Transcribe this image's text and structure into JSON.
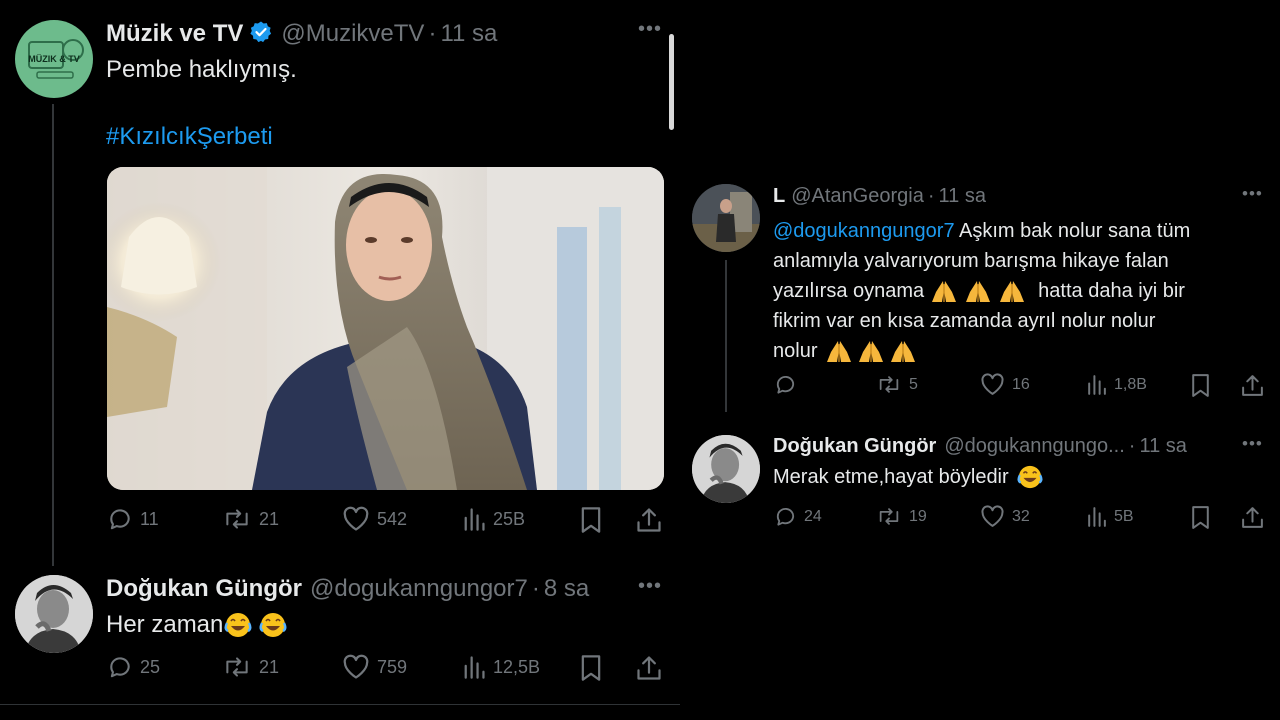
{
  "left": {
    "tweet1": {
      "avatar_text": "MÜZIK & TV",
      "name": "Müzik ve TV",
      "handle": "@MuzikveTV",
      "time": "11 sa",
      "text": "Pembe haklıymış.",
      "hashtag": "#KızılcıkŞerbeti",
      "stats": {
        "replies": "11",
        "retweets": "21",
        "likes": "542",
        "views": "25B"
      }
    },
    "tweet2": {
      "name": "Doğukan Güngör",
      "handle": "@dogukanngungor7",
      "time": "8 sa",
      "text": "Her zaman",
      "stats": {
        "replies": "25",
        "retweets": "21",
        "likes": "759",
        "views": "12,5B"
      }
    }
  },
  "right": {
    "tweet1": {
      "name": "L",
      "handle": "@AtanGeorgia",
      "time": "11 sa",
      "mention": "@dogukanngungor7",
      "text_line1": " Aşkım bak nolur sana tüm",
      "text_line2": "anlamıyla yalvarıyorum barışma hikaye falan",
      "text_line3": "yazılırsa oynama",
      "text_line3b": "hatta daha iyi bir",
      "text_line4": "fikrim var en kısa zamanda ayrıl nolur nolur",
      "text_line5": "nolur",
      "stats": {
        "replies": "",
        "retweets": "5",
        "likes": "16",
        "views": "1,8B"
      }
    },
    "tweet2": {
      "name": "Doğukan Güngör",
      "handle": "@dogukanngungo...",
      "time": "11 sa",
      "text": "Merak etme,hayat böyledir",
      "stats": {
        "replies": "24",
        "retweets": "19",
        "likes": "32",
        "views": "5B"
      }
    }
  },
  "colors": {
    "background": "#000000",
    "text": "#e7e9ea",
    "muted": "#71767b",
    "link": "#1d9bf0",
    "verified": "#1d9bf0"
  },
  "icons": [
    "reply-icon",
    "retweet-icon",
    "like-icon",
    "views-icon",
    "bookmark-icon",
    "share-icon",
    "more-icon",
    "verified-icon",
    "pray-emoji",
    "laugh-emoji"
  ]
}
